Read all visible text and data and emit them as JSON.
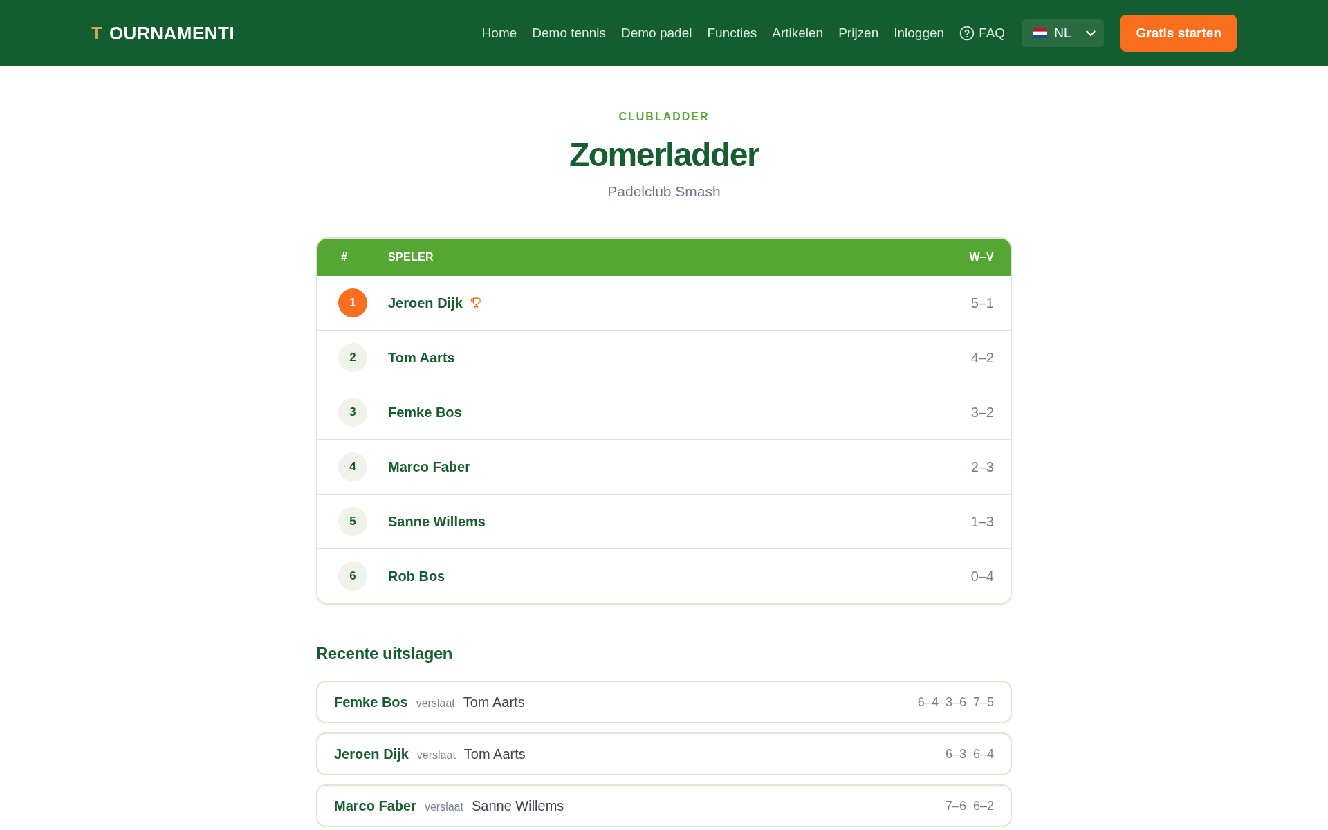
{
  "header": {
    "logo": {
      "initial": "T",
      "wordmark": "OURNAMENTI"
    },
    "nav": [
      "Home",
      "Demo tennis",
      "Demo padel",
      "Functies",
      "Artikelen",
      "Prijzen",
      "Inloggen"
    ],
    "faq": {
      "label": "FAQ"
    },
    "language": {
      "value": "NL"
    },
    "cta": {
      "label": "Gratis starten"
    }
  },
  "ladder": {
    "eyebrow": "CLUBLADDER",
    "title": "Zomerladder",
    "club": "Padelclub Smash",
    "table": {
      "columns": [
        "#",
        "SPELER",
        "W–V"
      ],
      "rows": [
        {
          "rank": "1",
          "player": "Jeroen Dijk",
          "record": "5–1",
          "leader": true
        },
        {
          "rank": "2",
          "player": "Tom Aarts",
          "record": "4–2",
          "leader": false
        },
        {
          "rank": "3",
          "player": "Femke Bos",
          "record": "3–2",
          "leader": false
        },
        {
          "rank": "4",
          "player": "Marco Faber",
          "record": "2–3",
          "leader": false
        },
        {
          "rank": "5",
          "player": "Sanne Willems",
          "record": "1–3",
          "leader": false
        },
        {
          "rank": "6",
          "player": "Rob Bos",
          "record": "0–4",
          "leader": false
        }
      ]
    }
  },
  "recent_results": {
    "title": "Recente uitslagen",
    "matches": [
      {
        "winner": "Femke Bos",
        "verb": "verslaat",
        "loser": "Tom Aarts",
        "sets": [
          "6–4",
          "3–6",
          "7–5"
        ]
      },
      {
        "winner": "Jeroen Dijk",
        "verb": "verslaat",
        "loser": "Tom Aarts",
        "sets": [
          "6–3",
          "6–4"
        ]
      },
      {
        "winner": "Marco Faber",
        "verb": "verslaat",
        "loser": "Sanne Willems",
        "sets": [
          "7–6",
          "6–2"
        ]
      }
    ]
  }
}
